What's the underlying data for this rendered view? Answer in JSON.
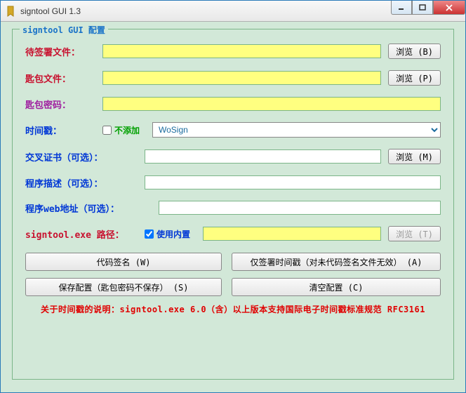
{
  "window": {
    "title": "signtool GUI 1.3"
  },
  "group": {
    "title": "signtool GUI 配置"
  },
  "rows": {
    "file_label": "待签署文件：",
    "file_value": "",
    "browse_b": "浏览 (B)",
    "key_label": "匙包文件：",
    "key_value": "",
    "browse_p": "浏览 (P)",
    "pwd_label": "匙包密码：",
    "pwd_value": "",
    "ts_label": "时间戳：",
    "ts_checkbox": "不添加",
    "ts_select": "WoSign",
    "cross_label": "交叉证书（可选）：",
    "cross_value": "",
    "browse_m": "浏览 (M)",
    "desc_label": "程序描述（可选）：",
    "desc_value": "",
    "web_label": "程序web地址（可选）：",
    "web_value": "",
    "path_label": "signtool.exe 路径：",
    "path_checkbox": "使用内置",
    "path_value": "",
    "browse_t": "浏览 (T)"
  },
  "buttons": {
    "sign": "代码签名 (W)",
    "ts_only": "仅签署时间戳（对未代码签名文件无效） (A)",
    "save_cfg": "保存配置（匙包密码不保存） (S)",
    "clear_cfg": "清空配置 (C)"
  },
  "footer": "关于时间戳的说明：signtool.exe 6.0（含）以上版本支持国际电子时间戳标准规范 RFC3161"
}
